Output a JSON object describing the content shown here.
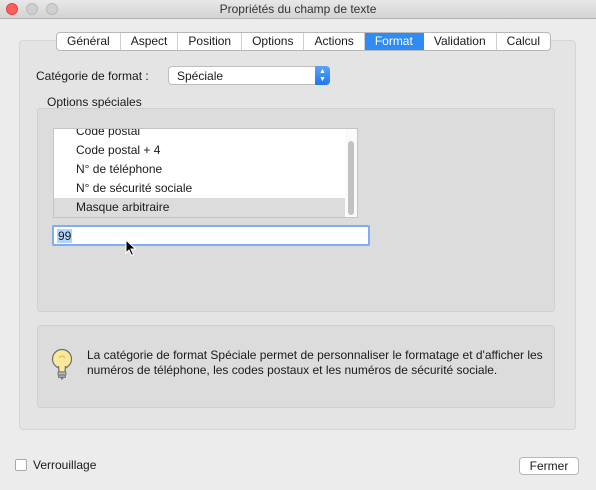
{
  "window": {
    "title": "Propriétés du champ de texte"
  },
  "tabs": [
    {
      "label": "Général"
    },
    {
      "label": "Aspect"
    },
    {
      "label": "Position"
    },
    {
      "label": "Options"
    },
    {
      "label": "Actions"
    },
    {
      "label": "Format",
      "active": true
    },
    {
      "label": "Validation"
    },
    {
      "label": "Calcul"
    }
  ],
  "format": {
    "category_label": "Catégorie de format :",
    "category_value": "Spéciale"
  },
  "special_options": {
    "group_label": "Options spéciales",
    "items": [
      {
        "label": "Code postal"
      },
      {
        "label": "Code postal + 4"
      },
      {
        "label": "N° de téléphone"
      },
      {
        "label": "N° de sécurité sociale"
      },
      {
        "label": "Masque arbitraire",
        "selected": true
      }
    ],
    "mask_value": "99"
  },
  "info": {
    "icon": "lightbulb-icon",
    "text_line1": "La catégorie de format Spéciale permet de personnaliser le formatage et d'afficher les",
    "text_line2": "numéros de téléphone, les codes postaux et les numéros de sécurité sociale."
  },
  "footer": {
    "lock_label": "Verrouillage",
    "lock_checked": false,
    "close_label": "Fermer"
  },
  "colors": {
    "accent": "#2f8cf4",
    "selection": "#b3d4fe",
    "close_light": "#fc605b"
  }
}
